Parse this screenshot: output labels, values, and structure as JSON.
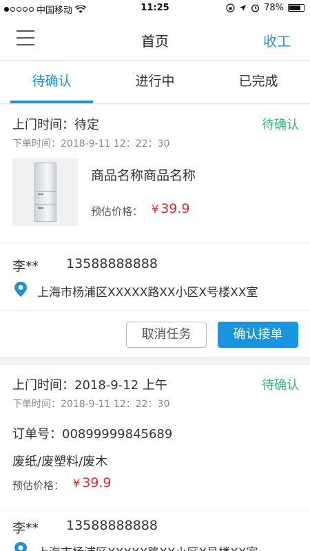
{
  "status_bar": {
    "carrier": "中国移动",
    "time": "11:25",
    "battery": "78%",
    "battery_level": 0.78
  },
  "nav": {
    "title": "首页",
    "action": "收工"
  },
  "tabs": [
    {
      "label": "待确认",
      "active": true
    },
    {
      "label": "进行中",
      "active": false
    },
    {
      "label": "已完成",
      "active": false
    }
  ],
  "order1": {
    "visit_label": "上门时间：",
    "visit_time": "待定",
    "status": "待确认",
    "order_time": "下单时间：2018-9-11 12：22：30",
    "product_name": "商品名称商品名称",
    "price_label": "预估价格：",
    "currency": "¥",
    "price": "39.9",
    "contact_name": "李**",
    "contact_phone": "13588888888",
    "address": "上海市杨浦区XXXXX路XX小区X号楼XX室",
    "cancel_label": "取消任务",
    "confirm_label": "确认接单"
  },
  "order2": {
    "visit_label": "上门时间：",
    "visit_time": "2018-9-12  上午",
    "status": "待确认",
    "order_time": "下单时间：2018-9-11 12：22：30",
    "order_no_label": "订单号：",
    "order_no": "00899999845689",
    "items": "废纸/废塑料/废木",
    "price_label": "预估价格：",
    "currency": "¥",
    "price": "39.9",
    "contact_name": "李**",
    "contact_phone": "13588888888",
    "address": "上海市杨浦区XXXXX路XX小区X号楼XX室"
  }
}
